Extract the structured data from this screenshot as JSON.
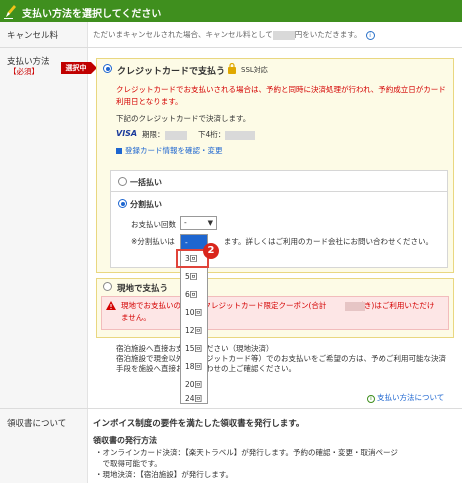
{
  "header": {
    "title": "支払い方法を選択してください"
  },
  "cancel": {
    "label": "キャンセル料",
    "text_before": "ただいまキャンセルされた場合、キャンセル料として",
    "text_after": "円をいただきます。",
    "info_icon": "info-icon"
  },
  "payment": {
    "label": "支払い方法",
    "required": "【必須】",
    "selected_badge": "選択中",
    "credit": {
      "title": "クレジットカードで支払う",
      "ssl": "SSL対応",
      "warning": "クレジットカードでお支払いされる場合は、予約と同時に決済処理が行われ、予約成立日がカード利用日となります。",
      "note": "下記のクレジットカードで決済します。",
      "brand": "VISA",
      "expiry_label": "期限：",
      "last4_label": "下4桁：",
      "link": "登録カード情報を確認・変更"
    },
    "lump_sum": "一括払い",
    "installment": {
      "title": "分割払い",
      "count_label": "お支払い回数",
      "selected_value": "-",
      "note_before": "※分割払いは",
      "note_after": "ます。詳しくはご利用のカード会社にお問い合わせください。",
      "options": [
        "-",
        "3回",
        "5回",
        "6回",
        "10回",
        "12回",
        "15回",
        "18回",
        "20回",
        "24回"
      ]
    },
    "onsite": {
      "title": "現地で支払う",
      "alert": "現地でお支払いの場合、クレジットカード限定クーポン(合計　　　円引き)はご利用いただけません。",
      "note1": "宿泊施設へ直接お支払いください（現地決済）",
      "note2": "宿泊施設で現金以外（クレジットカード等）でのお支払いをご希望の方は、予めご利用可能な決済手段を施設へ直接お問い合わせの上ご確認ください。"
    },
    "info_link": "支払い方法について",
    "badge_number": "2"
  },
  "receipt": {
    "label": "領収書について",
    "title": "インボイス制度の要件を満たした領収書を発行します。",
    "subtitle": "領収書の発行方法",
    "line1": "・オンラインカード決済：【楽天トラベル】が発行します。予約の確認・変更・取消ページ",
    "line2": "　で取得可能です。",
    "line3": "・現地決済：【宿泊施設】が発行します。"
  }
}
